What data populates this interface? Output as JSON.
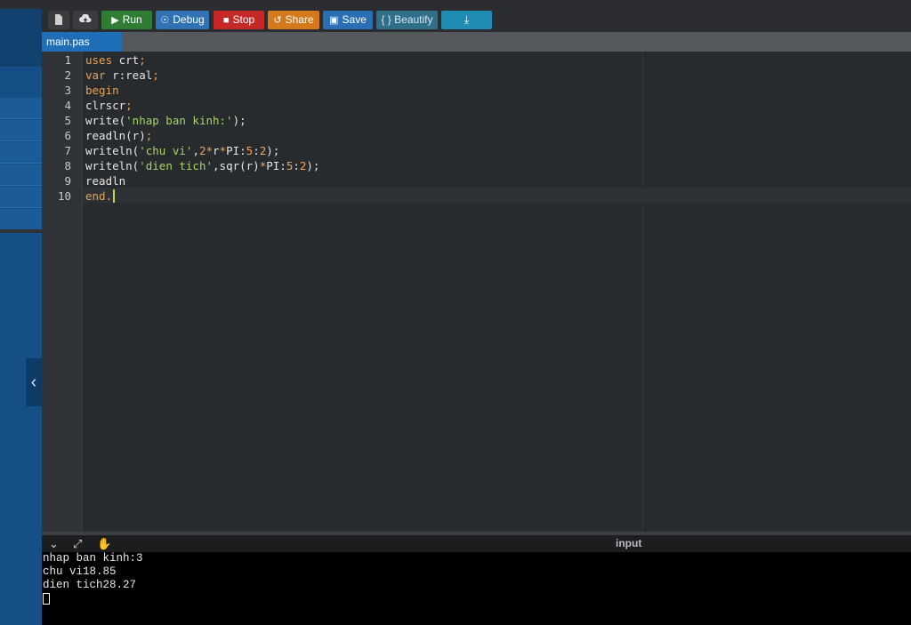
{
  "toolbar": {
    "run_label": "Run",
    "debug_label": "Debug",
    "stop_label": "Stop",
    "share_label": "Share",
    "save_label": "Save",
    "beautify_label": "{ } Beautify",
    "colors": {
      "run": "#2e7d32",
      "debug": "#2f73b4",
      "stop": "#c62828",
      "share": "#d57a1c",
      "save": "#2a6fb3",
      "beautify": "#2f6f8a",
      "download": "#1f8db3"
    }
  },
  "tabs": [
    {
      "label": "main.pas",
      "active": true
    }
  ],
  "editor": {
    "line_numbers": [
      "1",
      "2",
      "3",
      "4",
      "5",
      "6",
      "7",
      "8",
      "9",
      "10"
    ],
    "lines": [
      {
        "tokens": [
          {
            "t": "uses",
            "c": "kw"
          },
          {
            "t": " crt"
          },
          {
            "t": ";",
            "c": "op"
          }
        ]
      },
      {
        "tokens": [
          {
            "t": "var",
            "c": "kw"
          },
          {
            "t": " r:real"
          },
          {
            "t": ";",
            "c": "op"
          }
        ]
      },
      {
        "tokens": [
          {
            "t": "begin",
            "c": "kw"
          }
        ]
      },
      {
        "tokens": [
          {
            "t": "clrscr"
          },
          {
            "t": ";",
            "c": "op"
          }
        ]
      },
      {
        "tokens": [
          {
            "t": "write("
          },
          {
            "t": "'nhap ban kinh:'",
            "c": "str"
          },
          {
            "t": ");"
          }
        ]
      },
      {
        "tokens": [
          {
            "t": "readln(r)"
          },
          {
            "t": ";",
            "c": "op"
          }
        ]
      },
      {
        "tokens": [
          {
            "t": "writeln("
          },
          {
            "t": "'chu vi'",
            "c": "str"
          },
          {
            "t": ","
          },
          {
            "t": "2",
            "c": "num"
          },
          {
            "t": "*",
            "c": "op"
          },
          {
            "t": "r"
          },
          {
            "t": "*",
            "c": "op"
          },
          {
            "t": "PI:"
          },
          {
            "t": "5",
            "c": "num"
          },
          {
            "t": ":"
          },
          {
            "t": "2",
            "c": "num"
          },
          {
            "t": ");"
          }
        ]
      },
      {
        "tokens": [
          {
            "t": "writeln("
          },
          {
            "t": "'dien tich'",
            "c": "str"
          },
          {
            "t": ",sqr(r)"
          },
          {
            "t": "*",
            "c": "op"
          },
          {
            "t": "PI:"
          },
          {
            "t": "5",
            "c": "num"
          },
          {
            "t": ":"
          },
          {
            "t": "2",
            "c": "num"
          },
          {
            "t": ");"
          }
        ]
      },
      {
        "tokens": [
          {
            "t": "readln"
          }
        ]
      },
      {
        "tokens": [
          {
            "t": "end",
            "c": "kw"
          },
          {
            "t": ".",
            "c": "op"
          }
        ]
      }
    ]
  },
  "output": {
    "input_label": "input",
    "lines": [
      "nhap ban kinh:3",
      "chu vi18.85",
      "dien tich28.27"
    ]
  }
}
